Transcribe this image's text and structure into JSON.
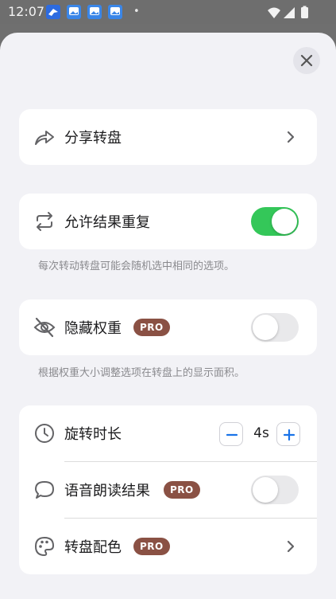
{
  "status_bar": {
    "time": "12:07",
    "dot": "•",
    "icons": [
      "bird-app-icon",
      "photo-app-icon",
      "photo-app-icon",
      "photo-app-icon"
    ],
    "right_icons": [
      "wifi-icon",
      "signal-icon",
      "battery-icon"
    ]
  },
  "close": {
    "icon": "close-icon"
  },
  "share": {
    "label": "分享转盘",
    "icon": "share-icon"
  },
  "allow_repeat": {
    "label": "允许结果重复",
    "icon": "repeat-icon",
    "enabled": true,
    "caption": "每次转动转盘可能会随机选中相同的选项。"
  },
  "hide_weight": {
    "label": "隐藏权重",
    "badge": "PRO",
    "icon": "eye-off-icon",
    "enabled": false,
    "caption": "根据权重大小调整选项在转盘上的显示面积。"
  },
  "spin_duration": {
    "label": "旋转时长",
    "icon": "clock-icon",
    "value": "4s"
  },
  "voice_result": {
    "label": "语音朗读结果",
    "badge": "PRO",
    "icon": "speech-bubble-icon",
    "enabled": false
  },
  "wheel_colors": {
    "label": "转盘配色",
    "badge": "PRO",
    "icon": "palette-icon"
  },
  "colors": {
    "accent_green": "#34c759",
    "pro_badge": "#8a5144",
    "stepper_blue": "#1a73e8"
  }
}
